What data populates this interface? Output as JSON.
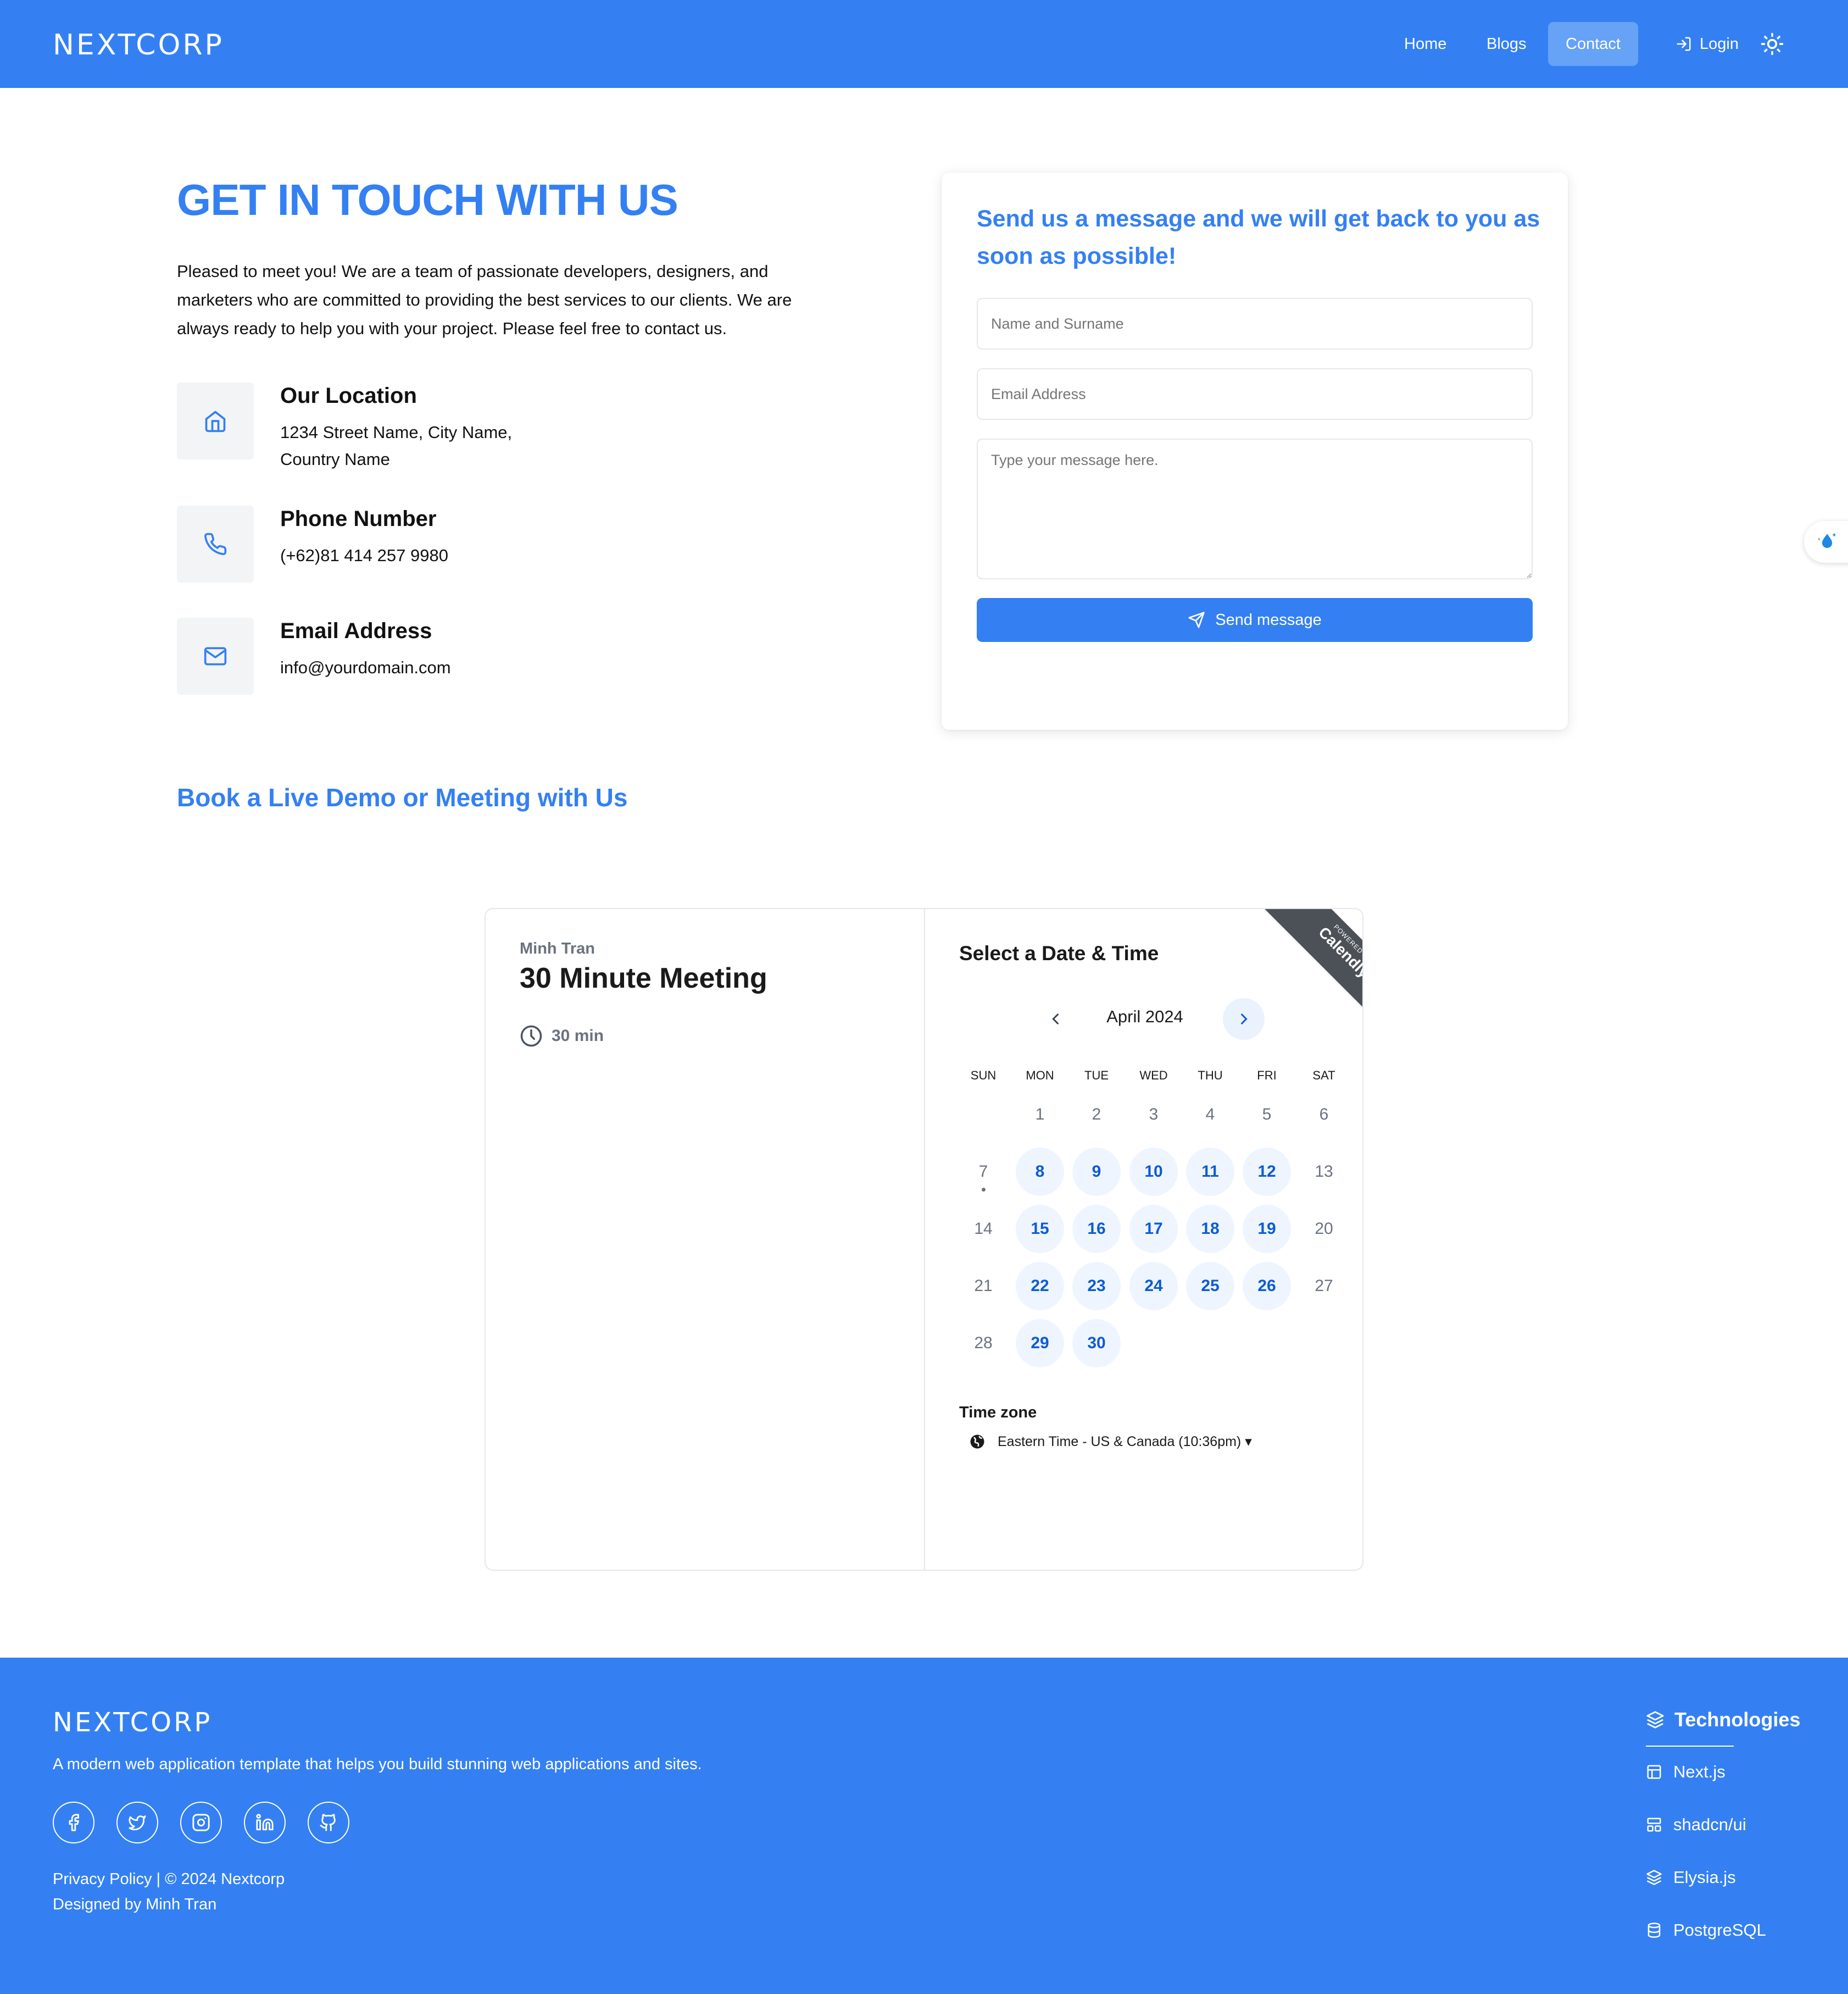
{
  "header": {
    "logo": "NEXTCORP",
    "nav": {
      "home": "Home",
      "blogs": "Blogs",
      "contact": "Contact",
      "login": "Login"
    }
  },
  "hero": {
    "title": "GET IN TOUCH WITH US",
    "text": "Pleased to meet you! We are a team of passionate developers, designers, and marketers who are committed to providing the best services to our clients. We are always ready to help you with your project. Please feel free to contact us."
  },
  "contact_info": {
    "location_title": "Our Location",
    "location_line1": "1234 Street Name, City Name,",
    "location_line2": "Country Name",
    "phone_title": "Phone Number",
    "phone_value": "(+62)81 414 257 9980",
    "email_title": "Email Address",
    "email_value": "info@yourdomain.com"
  },
  "form": {
    "title": "Send us a message and we will get back to you as soon as possible!",
    "name_placeholder": "Name and Surname",
    "email_placeholder": "Email Address",
    "message_placeholder": "Type your message here.",
    "send_label": "Send message"
  },
  "demo": {
    "title": "Book a Live Demo or Meeting with Us"
  },
  "calendly": {
    "host": "Minh Tran",
    "event": "30 Minute Meeting",
    "duration": "30 min",
    "select_title": "Select a Date & Time",
    "month": "April 2024",
    "weekdays": [
      "SUN",
      "MON",
      "TUE",
      "WED",
      "THU",
      "FRI",
      "SAT"
    ],
    "weeks": [
      [
        "",
        "1",
        "2",
        "3",
        "4",
        "5",
        "6"
      ],
      [
        "7",
        "8",
        "9",
        "10",
        "11",
        "12",
        "13"
      ],
      [
        "14",
        "15",
        "16",
        "17",
        "18",
        "19",
        "20"
      ],
      [
        "21",
        "22",
        "23",
        "24",
        "25",
        "26",
        "27"
      ],
      [
        "28",
        "29",
        "30",
        "",
        "",
        "",
        ""
      ]
    ],
    "available": [
      "8",
      "9",
      "10",
      "11",
      "12",
      "15",
      "16",
      "17",
      "18",
      "19",
      "22",
      "23",
      "24",
      "25",
      "26",
      "29",
      "30"
    ],
    "today": "7",
    "timezone_label": "Time zone",
    "timezone_value": "Eastern Time - US & Canada (10:36pm) ▾",
    "ribbon_small": "POWERED BY",
    "ribbon_big": "Calendly"
  },
  "footer": {
    "logo": "NEXTCORP",
    "tagline": "A modern web application template that helps you build stunning web applications and sites.",
    "copyright": "Privacy Policy | © 2024 Nextcorp",
    "designed_by": "Designed by Minh Tran",
    "tech_title": "Technologies",
    "tech": [
      "Next.js",
      "shadcn/ui",
      "Elysia.js",
      "PostgreSQL"
    ]
  },
  "colors": {
    "primary": "#3480f3",
    "nav_active": "#66a2f6",
    "calendar_day_bg": "#eff5fe",
    "calendar_day_text": "#0b5bd6",
    "ribbon": "#4b5157"
  }
}
